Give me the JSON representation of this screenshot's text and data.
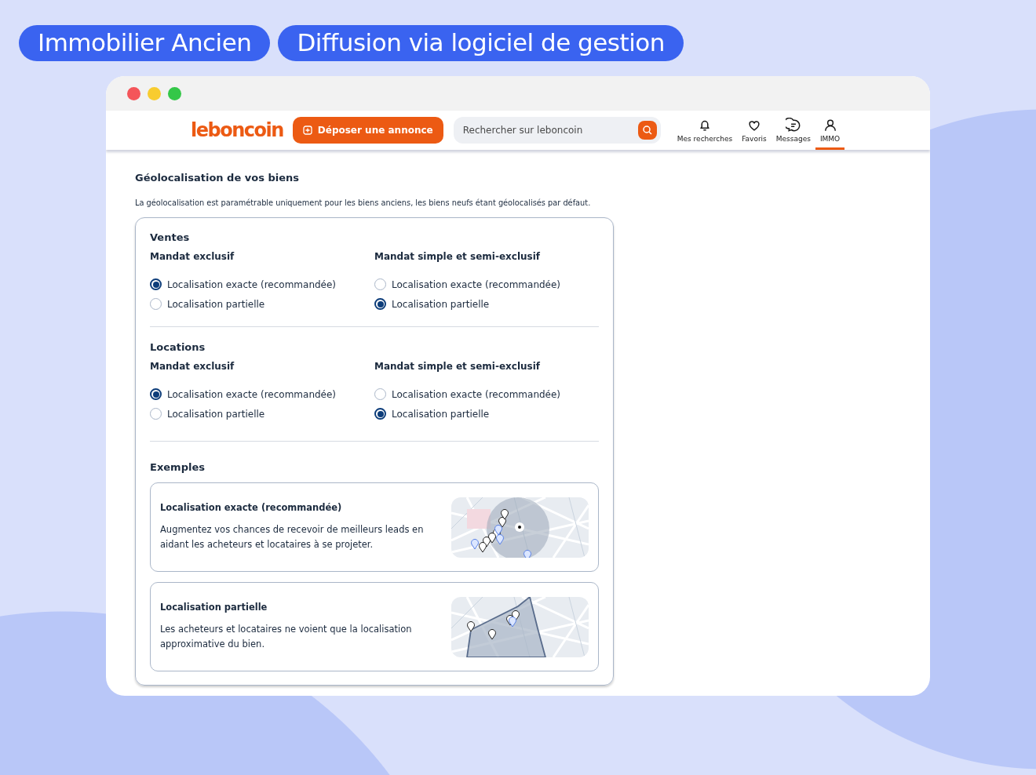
{
  "tags": [
    "Immobilier Ancien",
    "Diffusion via logiciel de gestion"
  ],
  "header": {
    "logo": "leboncoin",
    "post_button": "Déposer une annonce",
    "search": {
      "placeholder": "Rechercher sur leboncoin"
    },
    "nav": [
      {
        "label": "Mes recherches",
        "selected": false
      },
      {
        "label": "Favoris",
        "selected": false
      },
      {
        "label": "Messages",
        "selected": false
      },
      {
        "label": "IMMO",
        "selected": true
      }
    ]
  },
  "page": {
    "title": "Géolocalisation de vos biens",
    "description": "La géolocalisation est paramétrable uniquement pour les biens anciens, les biens neufs étant géolocalisés par défaut.",
    "sections": [
      {
        "title": "Ventes",
        "groups": [
          {
            "title": "Mandat exclusif",
            "options": [
              {
                "label": "Localisation exacte (recommandée)",
                "selected": true
              },
              {
                "label": "Localisation partielle",
                "selected": false
              }
            ]
          },
          {
            "title": "Mandat simple et semi-exclusif",
            "options": [
              {
                "label": "Localisation exacte (recommandée)",
                "selected": false
              },
              {
                "label": "Localisation partielle",
                "selected": true
              }
            ]
          }
        ]
      },
      {
        "title": "Locations",
        "groups": [
          {
            "title": "Mandat exclusif",
            "options": [
              {
                "label": "Localisation exacte (recommandée)",
                "selected": true
              },
              {
                "label": "Localisation partielle",
                "selected": false
              }
            ]
          },
          {
            "title": "Mandat simple et semi-exclusif",
            "options": [
              {
                "label": "Localisation exacte (recommandée)",
                "selected": false
              },
              {
                "label": "Localisation partielle",
                "selected": true
              }
            ]
          }
        ]
      }
    ],
    "examples_title": "Exemples",
    "examples": [
      {
        "kind": "exact",
        "title": "Localisation exacte (recommandée)",
        "text": "Augmentez vos chances de recevoir de meilleurs leads en aidant les acheteurs et locataires à se projeter."
      },
      {
        "kind": "partial",
        "title": "Localisation partielle",
        "text": "Les acheteurs et locataires ne voient que la localisation approximative du bien."
      }
    ]
  }
}
